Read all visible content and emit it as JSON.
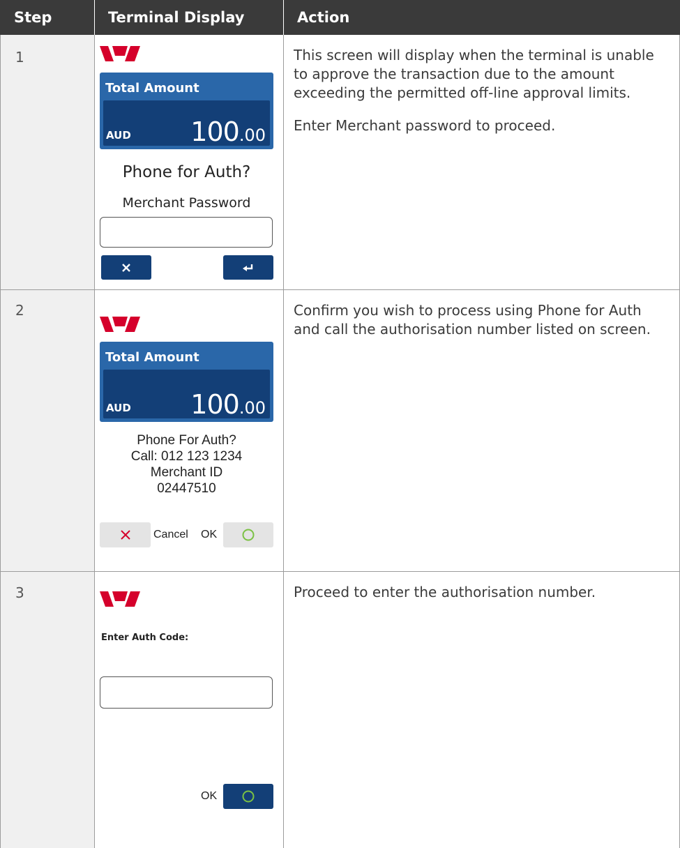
{
  "header": {
    "col_step": "Step",
    "col_display": "Terminal Display",
    "col_action": "Action"
  },
  "rows": [
    {
      "step": "1",
      "screen_title": "Total Amount",
      "currency": "AUD",
      "amount_main": "100",
      "amount_cents": ".00",
      "prompt": "Phone for Auth?",
      "field_label": "Merchant Password",
      "cancel_icon": "x-icon",
      "enter_icon": "enter-icon",
      "action": [
        "This screen will display when the terminal is unable to approve the transaction due to the amount exceeding the permitted off-line approval limits.",
        "Enter Merchant password to proceed."
      ]
    },
    {
      "step": "2",
      "screen_title": "Total Amount",
      "currency": "AUD",
      "amount_main": "100",
      "amount_cents": ".00",
      "lines": [
        "Phone For Auth?",
        "Call: 012 123 1234",
        "Merchant ID",
        "02447510"
      ],
      "cancel_label": "Cancel",
      "ok_label": "OK",
      "action": [
        "Confirm you wish to process using Phone for Auth and call the authorisation number listed on screen."
      ]
    },
    {
      "step": "3",
      "field_label": "Enter Auth Code:",
      "ok_label": "OK",
      "action": [
        "Proceed to enter the authorisation number."
      ]
    }
  ],
  "colors": {
    "header_bg": "#3a3a3a",
    "brand_red": "#d5002b",
    "screen_blue": "#2a67a9",
    "screen_dark": "#133f77",
    "ok_green": "#7bc144"
  }
}
